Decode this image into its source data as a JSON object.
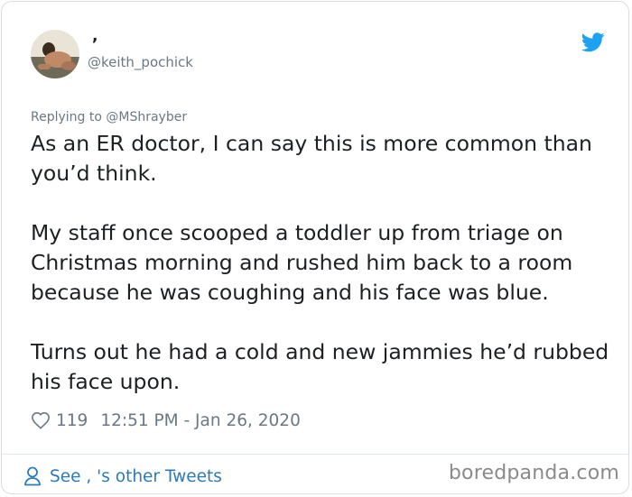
{
  "user": {
    "display_name": ",",
    "handle": "@keith_pochick"
  },
  "tweet": {
    "replying_to": "Replying to @MShrayber",
    "paragraphs": [
      "As an ER doctor, I can say this is more common than you’d think.",
      "My staff once scooped a toddler up from triage on Christmas morning and rushed him back to a room because he was coughing and his face was blue.",
      "Turns out he had a cold and new jammies he’d rubbed his face upon."
    ],
    "likes": "119",
    "timestamp": "12:51 PM - Jan 26, 2020"
  },
  "footer": {
    "see_more": "See  , 's other Tweets"
  },
  "watermark": "boredpanda.com",
  "colors": {
    "twitter_blue": "#1da1f2",
    "link_blue": "#2b7bb9",
    "text": "#1c2022",
    "muted": "#697882"
  },
  "icons": {
    "brand": "twitter-bird-icon",
    "like": "heart-outline-icon",
    "profile": "person-outline-icon"
  }
}
